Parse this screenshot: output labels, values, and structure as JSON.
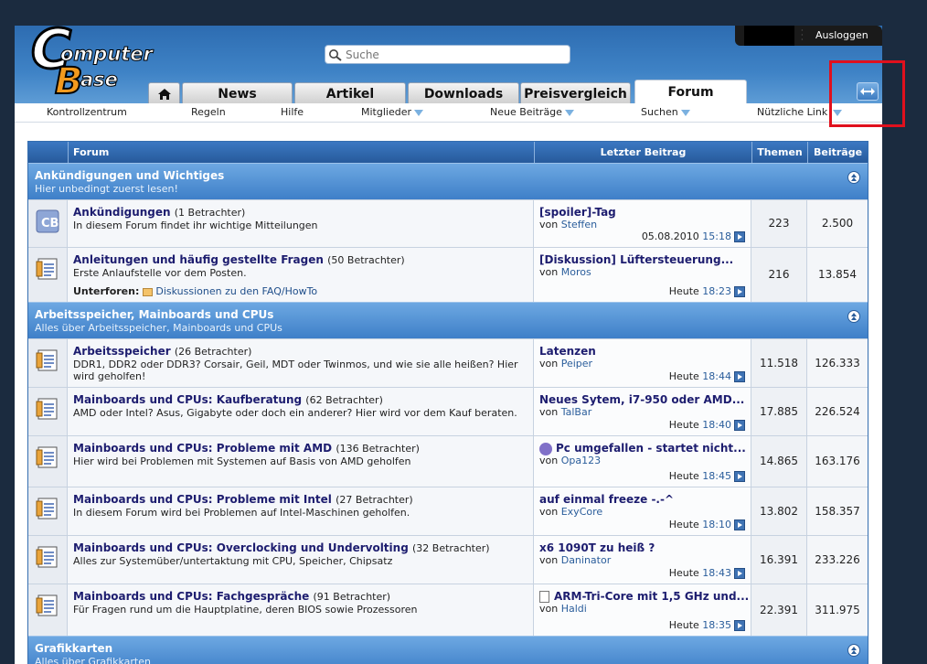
{
  "header": {
    "logout_label": "Ausloggen",
    "search_placeholder": "Suche",
    "logo": {
      "line1": "Computer",
      "line2": "Base"
    }
  },
  "tabs": [
    {
      "label": "News"
    },
    {
      "label": "Artikel"
    },
    {
      "label": "Downloads"
    },
    {
      "label": "Preisvergleich"
    },
    {
      "label": "Forum",
      "active": true
    }
  ],
  "subnav": [
    {
      "label": "Kontrollzentrum"
    },
    {
      "label": "Regeln"
    },
    {
      "label": "Hilfe"
    },
    {
      "label": "Mitglieder",
      "dropdown": true
    },
    {
      "label": "Neue Beiträge",
      "dropdown": true
    },
    {
      "label": "Suchen",
      "dropdown": true
    },
    {
      "label": "Nützliche Link",
      "dropdown": true
    }
  ],
  "table_header": {
    "forum": "Forum",
    "last_post": "Letzter Beitrag",
    "threads": "Themen",
    "posts": "Beiträge"
  },
  "categories": [
    {
      "title": "Ankündigungen und Wichtiges",
      "subtitle": "Hier unbedingt zuerst lesen!",
      "forums": [
        {
          "title": "Ankündigungen",
          "viewers": "(1 Betrachter)",
          "desc": "In diesem Forum findet ihr wichtige Mitteilungen",
          "last_title": "[spoiler]-Tag",
          "last_by": "von",
          "last_user": "Steffen",
          "last_date": "05.08.2010",
          "last_time": "15:18",
          "threads": "223",
          "posts": "2.500"
        },
        {
          "title": "Anleitungen und häufig gestellte Fragen",
          "viewers": "(50 Betrachter)",
          "desc": "Erste Anlaufstelle vor dem Posten.",
          "subforum_label": "Unterforen:",
          "subforum_link": "Diskussionen zu den FAQ/HowTo",
          "last_title": "[Diskussion] Lüftersteuerung...",
          "last_by": "von",
          "last_user": "Moros",
          "last_date": "Heute",
          "last_time": "18:23",
          "threads": "216",
          "posts": "13.854"
        }
      ]
    },
    {
      "title": "Arbeitsspeicher, Mainboards und CPUs",
      "subtitle": "Alles über Arbeitsspeicher, Mainboards und CPUs",
      "forums": [
        {
          "title": "Arbeitsspeicher",
          "viewers": "(26 Betrachter)",
          "desc": "DDR1, DDR2 oder DDR3? Corsair, Geil, MDT oder Twinmos, und wie sie alle heißen? Hier wird geholfen!",
          "last_title": "Latenzen",
          "last_by": "von",
          "last_user": "Peiper",
          "last_date": "Heute",
          "last_time": "18:44",
          "threads": "11.518",
          "posts": "126.333"
        },
        {
          "title": "Mainboards und CPUs: Kaufberatung",
          "viewers": "(62 Betrachter)",
          "desc": "AMD oder Intel? Asus, Gigabyte oder doch ein anderer? Hier wird vor dem Kauf beraten.",
          "last_title": "Neues Sytem, i7-950 oder AMD...",
          "last_by": "von",
          "last_user": "TalBar",
          "last_date": "Heute",
          "last_time": "18:40",
          "threads": "17.885",
          "posts": "226.524"
        },
        {
          "title": "Mainboards und CPUs: Probleme mit AMD",
          "viewers": "(136 Betrachter)",
          "desc": "Hier wird bei Problemen mit Systemen auf Basis von AMD geholfen",
          "last_title": "Pc umgefallen - startet nicht...",
          "last_icon": "sad-smiley",
          "last_by": "von",
          "last_user": "Opa123",
          "last_date": "Heute",
          "last_time": "18:45",
          "threads": "14.865",
          "posts": "163.176"
        },
        {
          "title": "Mainboards und CPUs: Probleme mit Intel",
          "viewers": "(27 Betrachter)",
          "desc": "In diesem Forum wird bei Problemen auf Intel-Maschinen geholfen.",
          "last_title": "auf einmal freeze -.-^",
          "last_by": "von",
          "last_user": "ExyCore",
          "last_date": "Heute",
          "last_time": "18:10",
          "threads": "13.802",
          "posts": "158.357"
        },
        {
          "title": "Mainboards und CPUs: Overclocking und Undervolting",
          "viewers": "(32 Betrachter)",
          "desc": "Alles zur Systemüber/untertaktung mit CPU, Speicher, Chipsatz",
          "last_title": "x6 1090T zu heiß ?",
          "last_by": "von",
          "last_user": "Daninator",
          "last_date": "Heute",
          "last_time": "18:43",
          "threads": "16.391",
          "posts": "233.226"
        },
        {
          "title": "Mainboards und CPUs: Fachgespräche",
          "viewers": "(91 Betrachter)",
          "desc": "Für Fragen rund um die Hauptplatine, deren BIOS sowie Prozessoren",
          "last_title": "ARM-Tri-Core mit 1,5 GHz und...",
          "last_icon": "document",
          "last_by": "von",
          "last_user": "Haldi",
          "last_date": "Heute",
          "last_time": "18:35",
          "threads": "22.391",
          "posts": "311.975"
        }
      ]
    },
    {
      "title": "Grafikkarten",
      "subtitle": "Alles über Grafikkarten",
      "forums": []
    }
  ],
  "colors": {
    "header_blue": "#3f83c6",
    "category_blue": "#4f8fd2",
    "link_dark": "#1d1d6f",
    "highlight_red": "#e0101d"
  }
}
